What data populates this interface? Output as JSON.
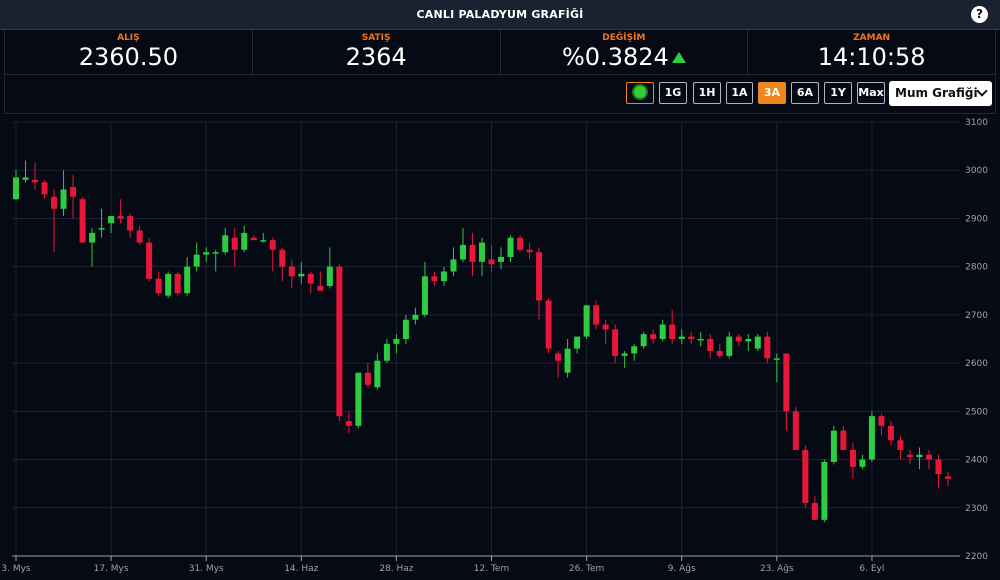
{
  "header": {
    "title": "CANLI PALADYUM GRAFİĞİ",
    "help_label": "?"
  },
  "stats": [
    {
      "label": "ALIŞ",
      "value": "2360.50"
    },
    {
      "label": "SATIŞ",
      "value": "2364"
    },
    {
      "label": "DEĞİŞİM",
      "value": "%0.3824"
    },
    {
      "label": "ZAMAN",
      "value": "14:10:58"
    }
  ],
  "toolbar": {
    "ranges": [
      "1G",
      "1H",
      "1A",
      "3A",
      "6A",
      "1Y",
      "Max"
    ],
    "active_range": "3A",
    "chart_type": "Mum Grafiği"
  },
  "colors": {
    "up": "#2ecc40",
    "down": "#e8173a",
    "accent": "#f0861e",
    "background": "#050a14"
  },
  "chart_data": {
    "type": "candlestick",
    "ylim": [
      2200,
      3100
    ],
    "yticks": [
      2200,
      2300,
      2400,
      2500,
      2600,
      2700,
      2800,
      2900,
      3000,
      3100
    ],
    "grid": true,
    "xticks": [
      {
        "label": "3. Mys",
        "index": 0
      },
      {
        "label": "17. Mys",
        "index": 10
      },
      {
        "label": "31. Mys",
        "index": 20
      },
      {
        "label": "14. Haz",
        "index": 30
      },
      {
        "label": "28. Haz",
        "index": 40
      },
      {
        "label": "12. Tem",
        "index": 50
      },
      {
        "label": "26. Tem",
        "index": 60
      },
      {
        "label": "9. Ağs",
        "index": 70
      },
      {
        "label": "23. Ağs",
        "index": 80
      },
      {
        "label": "6. Eyl",
        "index": 90
      }
    ],
    "candles": [
      [
        2940,
        3000,
        2938,
        2985
      ],
      [
        2980,
        3020,
        2975,
        2985
      ],
      [
        2980,
        3015,
        2960,
        2975
      ],
      [
        2975,
        2980,
        2940,
        2950
      ],
      [
        2945,
        2960,
        2830,
        2920
      ],
      [
        2920,
        3000,
        2905,
        2960
      ],
      [
        2965,
        2990,
        2900,
        2945
      ],
      [
        2940,
        2945,
        2850,
        2850
      ],
      [
        2850,
        2880,
        2800,
        2870
      ],
      [
        2880,
        2920,
        2860,
        2880
      ],
      [
        2890,
        2900,
        2870,
        2905
      ],
      [
        2905,
        2940,
        2890,
        2900
      ],
      [
        2905,
        2910,
        2860,
        2875
      ],
      [
        2875,
        2885,
        2845,
        2850
      ],
      [
        2850,
        2860,
        2770,
        2775
      ],
      [
        2775,
        2790,
        2740,
        2745
      ],
      [
        2740,
        2790,
        2735,
        2785
      ],
      [
        2785,
        2790,
        2740,
        2745
      ],
      [
        2745,
        2820,
        2740,
        2800
      ],
      [
        2800,
        2850,
        2790,
        2825
      ],
      [
        2825,
        2840,
        2810,
        2830
      ],
      [
        2830,
        2835,
        2790,
        2830
      ],
      [
        2830,
        2880,
        2825,
        2865
      ],
      [
        2860,
        2880,
        2800,
        2835
      ],
      [
        2835,
        2885,
        2830,
        2870
      ],
      [
        2860,
        2865,
        2855,
        2855
      ],
      [
        2855,
        2870,
        2850,
        2855
      ],
      [
        2855,
        2860,
        2790,
        2835
      ],
      [
        2835,
        2840,
        2770,
        2800
      ],
      [
        2800,
        2815,
        2755,
        2780
      ],
      [
        2780,
        2810,
        2765,
        2785
      ],
      [
        2785,
        2790,
        2745,
        2765
      ],
      [
        2760,
        2790,
        2755,
        2750
      ],
      [
        2760,
        2840,
        2755,
        2800
      ],
      [
        2800,
        2805,
        2480,
        2490
      ],
      [
        2480,
        2500,
        2455,
        2470
      ],
      [
        2470,
        2580,
        2465,
        2580
      ],
      [
        2580,
        2600,
        2550,
        2555
      ],
      [
        2550,
        2620,
        2545,
        2605
      ],
      [
        2605,
        2650,
        2600,
        2640
      ],
      [
        2640,
        2660,
        2620,
        2650
      ],
      [
        2650,
        2700,
        2640,
        2690
      ],
      [
        2690,
        2715,
        2680,
        2700
      ],
      [
        2700,
        2810,
        2695,
        2780
      ],
      [
        2780,
        2790,
        2760,
        2770
      ],
      [
        2770,
        2800,
        2760,
        2790
      ],
      [
        2790,
        2840,
        2780,
        2815
      ],
      [
        2815,
        2880,
        2810,
        2845
      ],
      [
        2845,
        2870,
        2780,
        2810
      ],
      [
        2810,
        2860,
        2780,
        2850
      ],
      [
        2815,
        2845,
        2790,
        2805
      ],
      [
        2810,
        2840,
        2795,
        2820
      ],
      [
        2820,
        2865,
        2810,
        2860
      ],
      [
        2860,
        2865,
        2830,
        2835
      ],
      [
        2835,
        2850,
        2815,
        2830
      ],
      [
        2830,
        2840,
        2690,
        2730
      ],
      [
        2730,
        2735,
        2620,
        2630
      ],
      [
        2620,
        2625,
        2570,
        2605
      ],
      [
        2580,
        2650,
        2570,
        2630
      ],
      [
        2630,
        2650,
        2620,
        2655
      ],
      [
        2655,
        2720,
        2650,
        2720
      ],
      [
        2720,
        2730,
        2670,
        2680
      ],
      [
        2680,
        2690,
        2640,
        2670
      ],
      [
        2670,
        2680,
        2600,
        2615
      ],
      [
        2615,
        2625,
        2590,
        2620
      ],
      [
        2620,
        2640,
        2605,
        2635
      ],
      [
        2635,
        2665,
        2630,
        2660
      ],
      [
        2660,
        2670,
        2640,
        2650
      ],
      [
        2650,
        2690,
        2645,
        2680
      ],
      [
        2680,
        2710,
        2640,
        2650
      ],
      [
        2650,
        2670,
        2640,
        2655
      ],
      [
        2655,
        2665,
        2640,
        2650
      ],
      [
        2650,
        2665,
        2635,
        2650
      ],
      [
        2650,
        2660,
        2610,
        2625
      ],
      [
        2625,
        2640,
        2610,
        2615
      ],
      [
        2615,
        2665,
        2610,
        2655
      ],
      [
        2655,
        2660,
        2635,
        2645
      ],
      [
        2645,
        2660,
        2625,
        2650
      ],
      [
        2630,
        2660,
        2625,
        2655
      ],
      [
        2655,
        2665,
        2600,
        2610
      ],
      [
        2610,
        2620,
        2560,
        2610
      ],
      [
        2620,
        2620,
        2460,
        2500
      ],
      [
        2500,
        2510,
        2420,
        2420
      ],
      [
        2420,
        2430,
        2300,
        2310
      ],
      [
        2310,
        2325,
        2275,
        2275
      ],
      [
        2275,
        2400,
        2270,
        2395
      ],
      [
        2395,
        2470,
        2390,
        2460
      ],
      [
        2460,
        2470,
        2420,
        2420
      ],
      [
        2420,
        2435,
        2360,
        2385
      ],
      [
        2385,
        2410,
        2380,
        2400
      ],
      [
        2400,
        2500,
        2395,
        2490
      ],
      [
        2490,
        2495,
        2450,
        2470
      ],
      [
        2470,
        2480,
        2430,
        2440
      ],
      [
        2440,
        2450,
        2400,
        2420
      ],
      [
        2410,
        2420,
        2390,
        2405
      ],
      [
        2405,
        2425,
        2380,
        2410
      ],
      [
        2410,
        2420,
        2380,
        2400
      ],
      [
        2400,
        2410,
        2340,
        2370
      ],
      [
        2365,
        2375,
        2345,
        2360
      ]
    ]
  }
}
